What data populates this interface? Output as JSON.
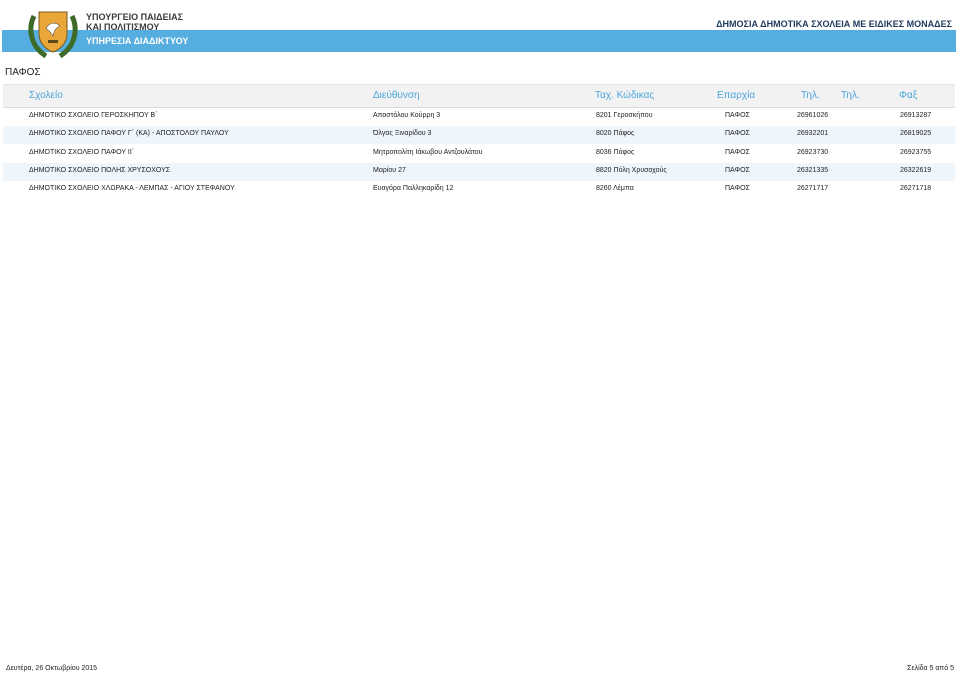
{
  "header": {
    "ministry_line1": "ΥΠΟΥΡΓΕΙΟ ΠΑΙΔΕΙΑΣ",
    "ministry_line2": "ΚΑΙ ΠΟΛΙΤΙΣΜΟΥ",
    "service": "ΥΠΗΡΕΣΙΑ ΔΙΑΔΙΚΤΥΟΥ",
    "title": "ΔΗΜΟΣΙΑ ΔΗΜΟΤΙΚΑ ΣΧΟΛΕΙΑ ΜΕ ΕΙΔΙΚΕΣ ΜΟΝΑΔΕΣ",
    "logo_icon": "cyprus-coat-of-arms-icon",
    "bar_color": "#56aee0"
  },
  "region": "ΠΑΦΟΣ",
  "columns": {
    "school": "Σχολείο",
    "address": "Διεύθυνση",
    "postcode": "Ταχ. Κώδικας",
    "province": "Επαρχία",
    "phone1": "Τηλ.",
    "phone2": "Τηλ.",
    "fax": "Φαξ"
  },
  "rows": [
    {
      "school": "ΔΗΜΟΤΙΚΟ ΣΧΟΛΕΙΟ ΓΕΡΟΣΚΗΠΟΥ Β΄",
      "address": "Αποστόλου Κούρρη 3",
      "postcode": "8201 Γεροσκήπου",
      "province": "ΠΑΦΟΣ",
      "phone": "26961026",
      "fax": "26913287"
    },
    {
      "school": "ΔΗΜΟΤΙΚΟ ΣΧΟΛΕΙΟ ΠΑΦΟΥ Γ΄ (ΚΑ) - ΑΠΟΣΤΟΛΟΥ ΠΑΥΛΟΥ",
      "address": "Όλγας Ξιναρίδου 3",
      "postcode": "8020 Πάφος",
      "province": "ΠΑΦΟΣ",
      "phone": "26932201",
      "fax": "26819025"
    },
    {
      "school": "ΔΗΜΟΤΙΚΟ ΣΧΟΛΕΙΟ ΠΑΦΟΥ ΙΙ΄",
      "address": "Μητροπολίτη Ιάκωβου Αντζουλάτου",
      "postcode": "8036 Πάφος",
      "province": "ΠΑΦΟΣ",
      "phone": "26923730",
      "fax": "26923755"
    },
    {
      "school": "ΔΗΜΟΤΙΚΟ ΣΧΟΛΕΙΟ ΠΟΛΗΣ ΧΡΥΣΟΧΟΥΣ",
      "address": "Μαρίου 27",
      "postcode": "8820 Πόλη Χρυσοχούς",
      "province": "ΠΑΦΟΣ",
      "phone": "26321335",
      "fax": "26322619"
    },
    {
      "school": "ΔΗΜΟΤΙΚΟ ΣΧΟΛΕΙΟ ΧΛΩΡΑΚΑ - ΛΕΜΠΑΣ - ΑΓΙΟΥ ΣΤΕΦΑΝΟΥ",
      "address": "Ευαγόρα Παλληκαρίδη 12",
      "postcode": "8260 Λέμπα",
      "province": "ΠΑΦΟΣ",
      "phone": "26271717",
      "fax": "26271718"
    }
  ],
  "footer": {
    "date": "Δευτέρα, 26 Οκτωβρίου 2015",
    "page": "Σελίδα 5 από 5"
  }
}
